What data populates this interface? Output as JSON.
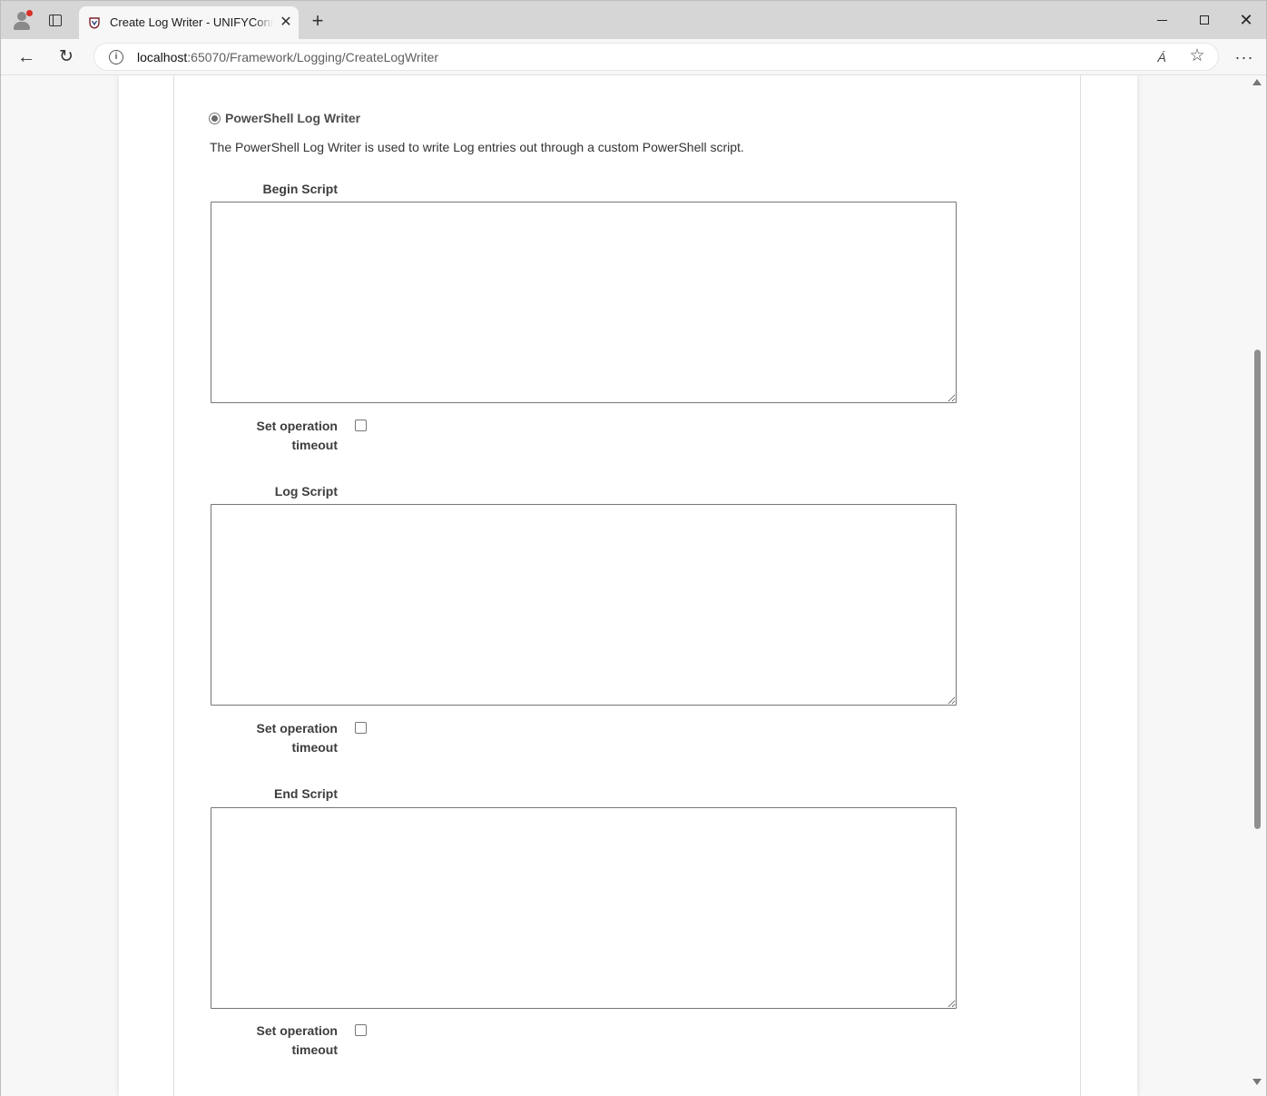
{
  "browser": {
    "tab_title": "Create Log Writer - UNIFYConnect",
    "tab_close": "✕",
    "new_tab": "+",
    "url_host": "localhost",
    "url_path": ":65070/Framework/Logging/CreateLogWriter",
    "back_glyph": "←",
    "reload_glyph": "↻",
    "more_glyph": "···",
    "favorite_glyph": "☆",
    "read_aloud_glyph": "Á",
    "close_glyph": "✕"
  },
  "form": {
    "writer_option_label": "PowerShell Log Writer",
    "writer_description": "The PowerShell Log Writer is used to write Log entries out through a custom PowerShell script.",
    "begin_script_label": "Begin Script",
    "begin_script_value": "",
    "log_script_label": "Log Script",
    "log_script_value": "",
    "end_script_label": "End Script",
    "end_script_value": "",
    "timeout_label_line1": "Set operation",
    "timeout_label_line2": "timeout"
  }
}
